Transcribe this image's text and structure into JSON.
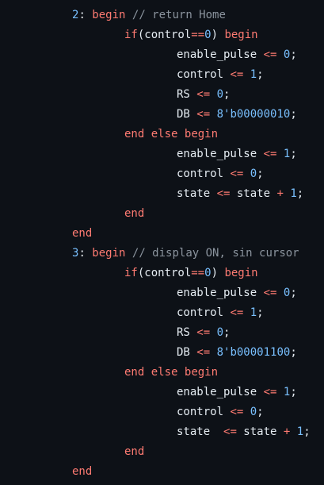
{
  "code_lines": [
    {
      "indent": 1,
      "tokens": [
        {
          "t": "num",
          "v": "2"
        },
        {
          "t": "id",
          "v": ": "
        },
        {
          "t": "kw",
          "v": "begin"
        },
        {
          "t": "id",
          "v": " "
        },
        {
          "t": "cm",
          "v": "// return Home"
        }
      ]
    },
    {
      "indent": 2,
      "tokens": [
        {
          "t": "kw",
          "v": "if"
        },
        {
          "t": "id",
          "v": "(control"
        },
        {
          "t": "op",
          "v": "=="
        },
        {
          "t": "num",
          "v": "0"
        },
        {
          "t": "id",
          "v": ") "
        },
        {
          "t": "kw",
          "v": "begin"
        }
      ]
    },
    {
      "indent": 3,
      "tokens": [
        {
          "t": "id",
          "v": "enable_pulse "
        },
        {
          "t": "op",
          "v": "<="
        },
        {
          "t": "id",
          "v": " "
        },
        {
          "t": "num",
          "v": "0"
        },
        {
          "t": "id",
          "v": ";"
        }
      ]
    },
    {
      "indent": 3,
      "tokens": [
        {
          "t": "id",
          "v": "control "
        },
        {
          "t": "op",
          "v": "<="
        },
        {
          "t": "id",
          "v": " "
        },
        {
          "t": "num",
          "v": "1"
        },
        {
          "t": "id",
          "v": ";"
        }
      ]
    },
    {
      "indent": 3,
      "tokens": [
        {
          "t": "id",
          "v": "RS "
        },
        {
          "t": "op",
          "v": "<="
        },
        {
          "t": "id",
          "v": " "
        },
        {
          "t": "num",
          "v": "0"
        },
        {
          "t": "id",
          "v": ";"
        }
      ]
    },
    {
      "indent": 3,
      "tokens": [
        {
          "t": "id",
          "v": "DB "
        },
        {
          "t": "op",
          "v": "<="
        },
        {
          "t": "id",
          "v": " "
        },
        {
          "t": "num",
          "v": "8'b00000010"
        },
        {
          "t": "id",
          "v": ";"
        }
      ]
    },
    {
      "indent": 2,
      "tokens": [
        {
          "t": "kw",
          "v": "end"
        },
        {
          "t": "id",
          "v": " "
        },
        {
          "t": "kw",
          "v": "else"
        },
        {
          "t": "id",
          "v": " "
        },
        {
          "t": "kw",
          "v": "begin"
        }
      ]
    },
    {
      "indent": 3,
      "tokens": [
        {
          "t": "id",
          "v": "enable_pulse "
        },
        {
          "t": "op",
          "v": "<="
        },
        {
          "t": "id",
          "v": " "
        },
        {
          "t": "num",
          "v": "1"
        },
        {
          "t": "id",
          "v": ";"
        }
      ]
    },
    {
      "indent": 3,
      "tokens": [
        {
          "t": "id",
          "v": "control "
        },
        {
          "t": "op",
          "v": "<="
        },
        {
          "t": "id",
          "v": " "
        },
        {
          "t": "num",
          "v": "0"
        },
        {
          "t": "id",
          "v": ";"
        }
      ]
    },
    {
      "indent": 3,
      "tokens": [
        {
          "t": "id",
          "v": "state "
        },
        {
          "t": "op",
          "v": "<="
        },
        {
          "t": "id",
          "v": " state "
        },
        {
          "t": "op",
          "v": "+"
        },
        {
          "t": "id",
          "v": " "
        },
        {
          "t": "num",
          "v": "1"
        },
        {
          "t": "id",
          "v": ";"
        }
      ]
    },
    {
      "indent": 2,
      "tokens": [
        {
          "t": "kw",
          "v": "end"
        }
      ]
    },
    {
      "indent": 1,
      "tokens": [
        {
          "t": "kw",
          "v": "end"
        }
      ]
    },
    {
      "indent": 1,
      "tokens": [
        {
          "t": "num",
          "v": "3"
        },
        {
          "t": "id",
          "v": ": "
        },
        {
          "t": "kw",
          "v": "begin"
        },
        {
          "t": "id",
          "v": " "
        },
        {
          "t": "cm",
          "v": "// display ON, sin cursor"
        }
      ]
    },
    {
      "indent": 2,
      "tokens": [
        {
          "t": "kw",
          "v": "if"
        },
        {
          "t": "id",
          "v": "(control"
        },
        {
          "t": "op",
          "v": "=="
        },
        {
          "t": "num",
          "v": "0"
        },
        {
          "t": "id",
          "v": ") "
        },
        {
          "t": "kw",
          "v": "begin"
        }
      ]
    },
    {
      "indent": 3,
      "tokens": [
        {
          "t": "id",
          "v": "enable_pulse "
        },
        {
          "t": "op",
          "v": "<="
        },
        {
          "t": "id",
          "v": " "
        },
        {
          "t": "num",
          "v": "0"
        },
        {
          "t": "id",
          "v": ";"
        }
      ]
    },
    {
      "indent": 3,
      "tokens": [
        {
          "t": "id",
          "v": "control "
        },
        {
          "t": "op",
          "v": "<="
        },
        {
          "t": "id",
          "v": " "
        },
        {
          "t": "num",
          "v": "1"
        },
        {
          "t": "id",
          "v": ";"
        }
      ]
    },
    {
      "indent": 3,
      "tokens": [
        {
          "t": "id",
          "v": "RS "
        },
        {
          "t": "op",
          "v": "<="
        },
        {
          "t": "id",
          "v": " "
        },
        {
          "t": "num",
          "v": "0"
        },
        {
          "t": "id",
          "v": ";"
        }
      ]
    },
    {
      "indent": 3,
      "tokens": [
        {
          "t": "id",
          "v": "DB "
        },
        {
          "t": "op",
          "v": "<="
        },
        {
          "t": "id",
          "v": " "
        },
        {
          "t": "num",
          "v": "8'b00001100"
        },
        {
          "t": "id",
          "v": ";"
        }
      ]
    },
    {
      "indent": 2,
      "tokens": [
        {
          "t": "kw",
          "v": "end"
        },
        {
          "t": "id",
          "v": " "
        },
        {
          "t": "kw",
          "v": "else"
        },
        {
          "t": "id",
          "v": " "
        },
        {
          "t": "kw",
          "v": "begin"
        }
      ]
    },
    {
      "indent": 3,
      "tokens": [
        {
          "t": "id",
          "v": "enable_pulse "
        },
        {
          "t": "op",
          "v": "<="
        },
        {
          "t": "id",
          "v": " "
        },
        {
          "t": "num",
          "v": "1"
        },
        {
          "t": "id",
          "v": ";"
        }
      ]
    },
    {
      "indent": 3,
      "tokens": [
        {
          "t": "id",
          "v": "control "
        },
        {
          "t": "op",
          "v": "<="
        },
        {
          "t": "id",
          "v": " "
        },
        {
          "t": "num",
          "v": "0"
        },
        {
          "t": "id",
          "v": ";"
        }
      ]
    },
    {
      "indent": 3,
      "tokens": [
        {
          "t": "id",
          "v": "state  "
        },
        {
          "t": "op",
          "v": "<="
        },
        {
          "t": "id",
          "v": " state "
        },
        {
          "t": "op",
          "v": "+"
        },
        {
          "t": "id",
          "v": " "
        },
        {
          "t": "num",
          "v": "1"
        },
        {
          "t": "id",
          "v": ";"
        }
      ]
    },
    {
      "indent": 2,
      "tokens": [
        {
          "t": "kw",
          "v": "end"
        }
      ]
    },
    {
      "indent": 1,
      "tokens": [
        {
          "t": "kw",
          "v": "end"
        }
      ]
    }
  ],
  "colors": {
    "background": "#0d1117",
    "keyword": "#ff7b72",
    "number": "#79c0ff",
    "comment": "#8b949e",
    "identifier": "#e6edf3"
  }
}
